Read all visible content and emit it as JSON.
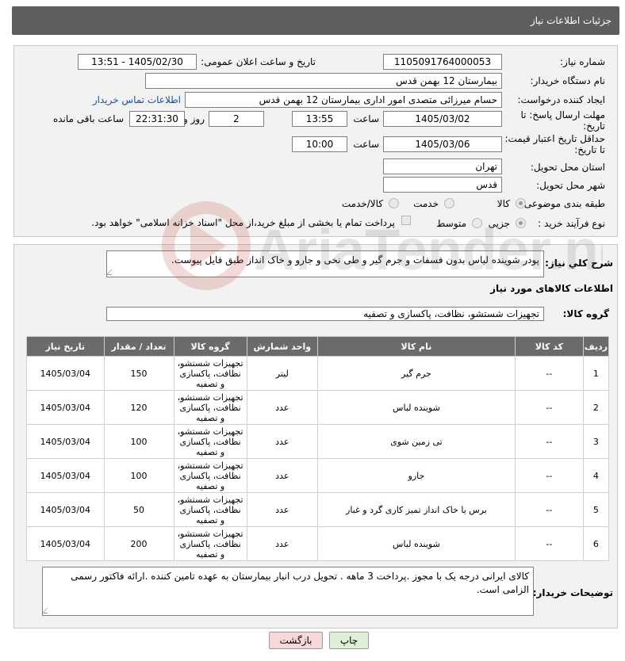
{
  "header": {
    "title": "جزئیات اطلاعات نیاز"
  },
  "form": {
    "need_number_label": "شماره نیاز:",
    "need_number": "1105091764000053",
    "announce_label": "تاریخ و ساعت اعلان عمومی:",
    "announce_value": "1405/02/30 - 13:51",
    "buyer_org_label": "نام دستگاه خریدار:",
    "buyer_org": "بیمارستان 12 بهمن قدس",
    "creator_label": "ایجاد کننده درخواست:",
    "creator": "حسام میرزائی متصدی امور اداری بیمارستان 12 بهمن قدس",
    "contact_link": "اطلاعات تماس خریدار",
    "reply_deadline_label_1": "مهلت ارسال پاسخ: تا",
    "reply_deadline_label_2": "تاریخ:",
    "reply_date": "1405/03/02",
    "time_label": "ساعت",
    "reply_time": "13:55",
    "days_value": "2",
    "days_label": "روز و",
    "remaining_time": "22:31:30",
    "remaining_label": "ساعت باقی مانده",
    "price_validity_label_1": "حداقل تاریخ اعتبار قیمت:",
    "price_validity_label_2": "تا تاریخ:",
    "price_date": "1405/03/06",
    "price_time_label": "ساعت",
    "price_time": "10:00",
    "province_label": "استان محل تحویل:",
    "province": "تهران",
    "city_label": "شهر محل تحویل:",
    "city": "قدس",
    "category_label": "طبقه بندی موضوعی:",
    "category_options": [
      "کالا",
      "خدمت",
      "کالا/خدمت"
    ],
    "process_label": "نوع فرآیند خرید :",
    "process_options": [
      "جزیی",
      "متوسط"
    ],
    "payment_note": "پرداخت تمام یا بخشی از مبلغ خرید،از محل \"اسناد خزانه اسلامی\" خواهد بود."
  },
  "description": {
    "label": "شرح کلي نياز:",
    "text": "پودر شوینده لباس بدون فسفات و جرم گیر و طی نخی و جارو و خاک انداز طبق فایل پیوست."
  },
  "goods": {
    "section_title": "اطلاعات کالاهای مورد نیاز",
    "group_label": "گروه کالا:",
    "group_value": "تجهیزات شستشو، نظافت، پاکسازی و تصفیه",
    "columns": [
      "ردیف",
      "کد کالا",
      "نام کالا",
      "واحد شمارش",
      "گروه کالا",
      "تعداد / مقدار",
      "تاریخ نیاز"
    ],
    "rows": [
      {
        "idx": "1",
        "code": "--",
        "name": "جرم گیر",
        "unit": "لیتر",
        "group": "تجهیزات شستشو، نظافت، پاکسازی و تصفیه",
        "qty": "150",
        "date": "1405/03/04"
      },
      {
        "idx": "2",
        "code": "--",
        "name": "شوینده لباس",
        "unit": "عدد",
        "group": "تجهیزات شستشو، نظافت، پاکسازی و تصفیه",
        "qty": "120",
        "date": "1405/03/04"
      },
      {
        "idx": "3",
        "code": "--",
        "name": "تی زمین شوی",
        "unit": "عدد",
        "group": "تجهیزات شستشو، نظافت، پاکسازی و تصفیه",
        "qty": "100",
        "date": "1405/03/04"
      },
      {
        "idx": "4",
        "code": "--",
        "name": "جارو",
        "unit": "عدد",
        "group": "تجهیزات شستشو، نظافت، پاکسازی و تصفیه",
        "qty": "100",
        "date": "1405/03/04"
      },
      {
        "idx": "5",
        "code": "--",
        "name": "برس یا خاک انداز تمیز کاری گرد و غبار",
        "unit": "عدد",
        "group": "تجهیزات شستشو، نظافت، پاکسازی و تصفیه",
        "qty": "50",
        "date": "1405/03/04"
      },
      {
        "idx": "6",
        "code": "--",
        "name": "شوینده لباس",
        "unit": "عدد",
        "group": "تجهیزات شستشو، نظافت، پاکسازی و تصفیه",
        "qty": "200",
        "date": "1405/03/04"
      }
    ]
  },
  "buyer_notes": {
    "label": "توضیحات خریدار:",
    "text": "کالای ایرانی درجه یک با مجوز .پرداخت 3 ماهه . تحویل درب انبار بیمارستان به عهده تامین کننده .ارائه فاکتور رسمی الزامی است."
  },
  "buttons": {
    "print": "چاپ",
    "back": "بازگشت"
  },
  "watermark": {
    "text": "AriaTender.net"
  },
  "colors": {
    "header_bg": "#5e5e5e",
    "link": "#1a4fa3",
    "back_btn": "#f8d7da",
    "print_btn": "#dff0d8"
  }
}
